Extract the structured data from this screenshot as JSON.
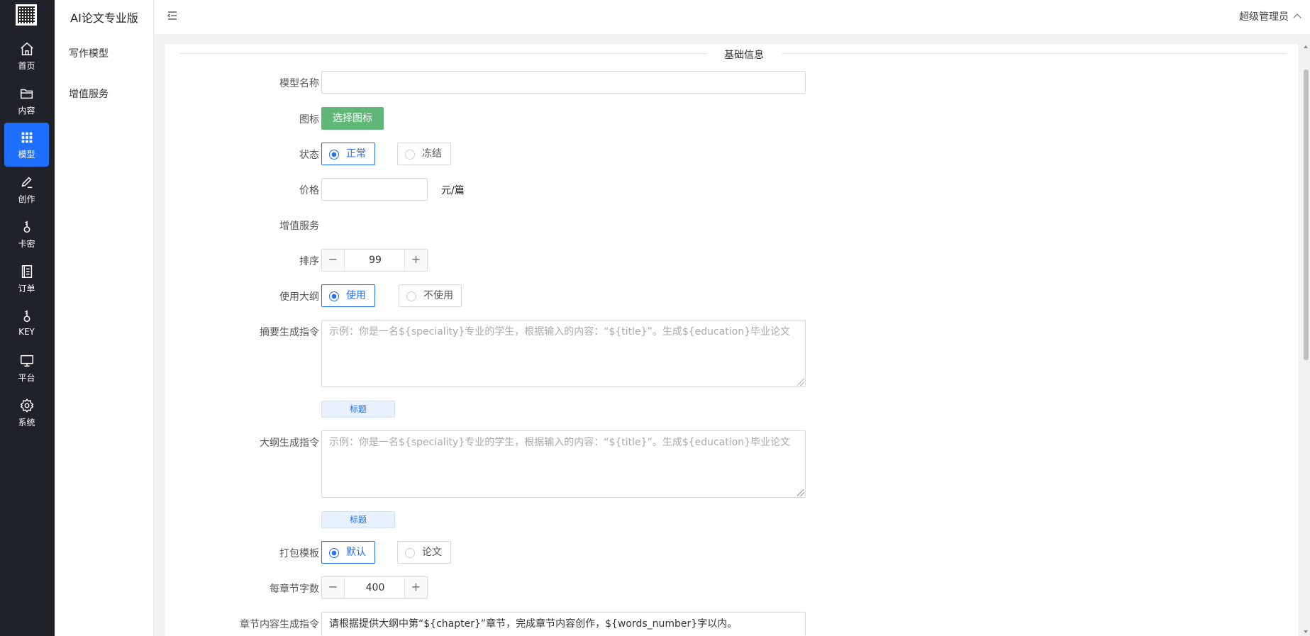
{
  "rail": {
    "items": [
      {
        "label": "首页",
        "icon": "home-icon"
      },
      {
        "label": "内容",
        "icon": "folder-icon"
      },
      {
        "label": "模型",
        "icon": "grid-icon",
        "active": true
      },
      {
        "label": "创作",
        "icon": "pen-icon"
      },
      {
        "label": "卡密",
        "icon": "key-icon"
      },
      {
        "label": "订单",
        "icon": "list-icon"
      },
      {
        "label": "KEY",
        "icon": "key-icon"
      },
      {
        "label": "平台",
        "icon": "monitor-icon"
      },
      {
        "label": "系统",
        "icon": "gear-icon"
      }
    ]
  },
  "sidebar": {
    "title": "AI论文专业版",
    "items": [
      {
        "label": "写作模型"
      },
      {
        "label": "增值服务"
      }
    ]
  },
  "header": {
    "user": "超级管理员"
  },
  "form": {
    "legend": "基础信息",
    "model_name": {
      "label": "模型名称",
      "value": ""
    },
    "icon": {
      "label": "图标",
      "button": "选择图标"
    },
    "status": {
      "label": "状态",
      "options": [
        "正常",
        "冻结"
      ],
      "selected": "正常"
    },
    "price": {
      "label": "价格",
      "value": "",
      "unit": "元/篇"
    },
    "addon": {
      "label": "增值服务"
    },
    "sort": {
      "label": "排序",
      "value": "99"
    },
    "use_outline": {
      "label": "使用大纲",
      "options": [
        "使用",
        "不使用"
      ],
      "selected": "使用"
    },
    "abstract_prompt": {
      "label": "摘要生成指令",
      "placeholder": "示例：你是一名${speciality}专业的学生，根据输入的内容：“${title}”。生成${education}毕业论文",
      "tag": "标题"
    },
    "outline_prompt": {
      "label": "大纲生成指令",
      "placeholder": "示例：你是一名${speciality}专业的学生，根据输入的内容：“${title}”。生成${education}毕业论文",
      "tag": "标题"
    },
    "package_template": {
      "label": "打包模板",
      "options": [
        "默认",
        "论文"
      ],
      "selected": "默认"
    },
    "words_per_chapter": {
      "label": "每章节字数",
      "value": "400"
    },
    "chapter_prompt": {
      "label": "章节内容生成指令",
      "value": "请根据提供大纲中第“${chapter}”章节，完成章节内容创作，${words_number}字以内。"
    }
  },
  "colors": {
    "rail_bg": "#20222a",
    "accent": "#1e6ffd",
    "green_button": "#5fb878"
  }
}
